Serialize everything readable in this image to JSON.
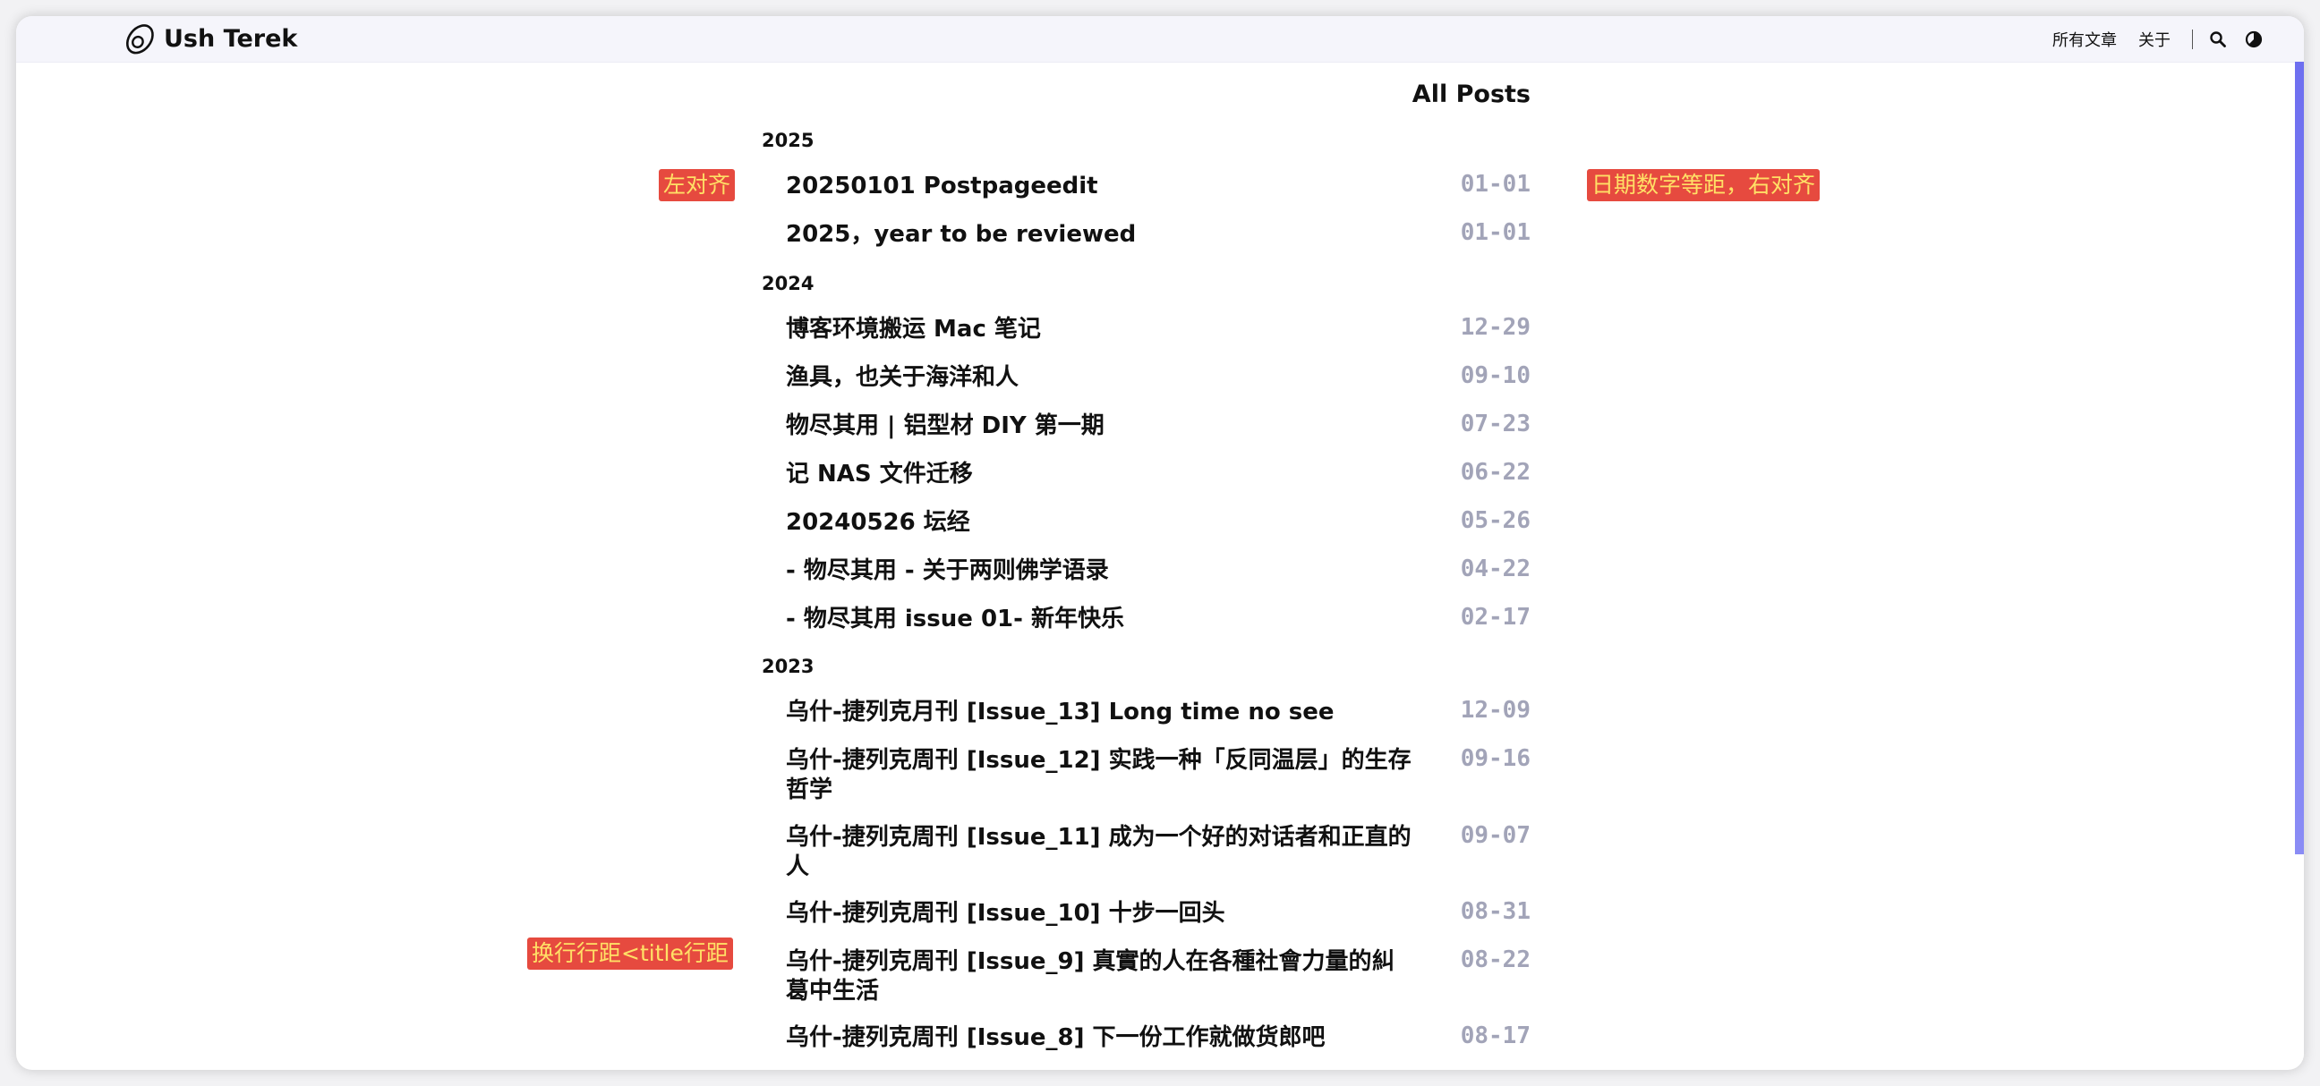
{
  "header": {
    "site_name": "Ush Terek",
    "nav": {
      "all_posts": "所有文章",
      "about": "关于"
    }
  },
  "page_title": "All Posts",
  "years": {
    "y2025": "2025",
    "y2024": "2024",
    "y2023": "2023"
  },
  "posts_2025": [
    {
      "title": "20250101 Postpageedit",
      "date": "01-01"
    },
    {
      "title": "2025，year to be reviewed",
      "date": "01-01"
    }
  ],
  "posts_2024": [
    {
      "title": "博客环境搬运 Mac 笔记",
      "date": "12-29"
    },
    {
      "title": "渔具，也关于海洋和人",
      "date": "09-10"
    },
    {
      "title": "物尽其用 | 铝型材 DIY 第一期",
      "date": "07-23"
    },
    {
      "title": "记 NAS 文件迁移",
      "date": "06-22"
    },
    {
      "title": "20240526 坛经",
      "date": "05-26"
    },
    {
      "title": "- 物尽其用 - 关于两则佛学语录",
      "date": "04-22"
    },
    {
      "title": "- 物尽其用 issue 01- 新年快乐",
      "date": "02-17"
    }
  ],
  "posts_2023": [
    {
      "title": "乌什-捷列克月刊 [Issue_13] Long time no see",
      "date": "12-09"
    },
    {
      "title": "乌什-捷列克周刊 [Issue_12] 实践一种「反同温层」的生存哲学",
      "date": "09-16"
    },
    {
      "title": "乌什-捷列克周刊 [Issue_11] 成为一个好的对话者和正直的人",
      "date": "09-07"
    },
    {
      "title": "乌什-捷列克周刊 [Issue_10] 十步一回头",
      "date": "08-31"
    },
    {
      "title": "乌什-捷列克周刊 [Issue_9] 真實的人在各種社會力量的糾葛中生活",
      "date": "08-22"
    },
    {
      "title": "乌什-捷列克周刊 [Issue_8] 下一份工作就做货郎吧",
      "date": "08-17"
    }
  ],
  "annotations": {
    "left_align": "左对齐",
    "date_align": "日期数字等距，右对齐",
    "line_spacing": "换行行距<title行距"
  },
  "colors": {
    "accent": "#7b7cf2",
    "date_gray": "#a2a4b8",
    "annotation_bg": "#e64a3f",
    "annotation_text": "#ffe066"
  },
  "icons": {
    "logo": "avocado-icon",
    "search": "search-icon",
    "theme": "theme-toggle-icon"
  }
}
